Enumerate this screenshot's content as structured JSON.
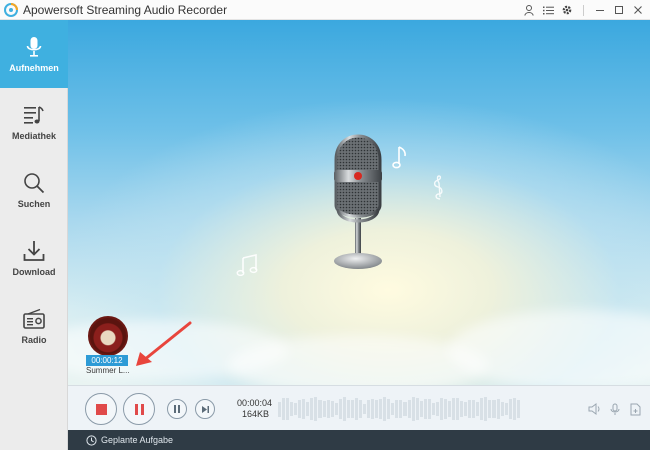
{
  "window": {
    "title": "Apowersoft Streaming Audio Recorder"
  },
  "titlebar_icons": [
    "user-icon",
    "list-icon",
    "gear-icon",
    "minimize-icon",
    "maximize-icon",
    "close-icon"
  ],
  "sidebar": {
    "items": [
      {
        "label": "Aufnehmen",
        "icon": "microphone-icon",
        "active": true
      },
      {
        "label": "Mediathek",
        "icon": "music-list-icon",
        "active": false
      },
      {
        "label": "Suchen",
        "icon": "search-icon",
        "active": false
      },
      {
        "label": "Download",
        "icon": "download-icon",
        "active": false
      },
      {
        "label": "Radio",
        "icon": "radio-icon",
        "active": false
      }
    ]
  },
  "recording_item": {
    "duration": "00:00:12",
    "title": "Summer L..."
  },
  "controls": {
    "elapsed": "00:00:04",
    "size": "164KB"
  },
  "status": {
    "scheduled_tasks_label": "Geplante Aufgabe"
  },
  "colors": {
    "accent": "#3fb0e0",
    "record_red": "#e04a4a",
    "annotation_arrow": "#e8453c"
  }
}
